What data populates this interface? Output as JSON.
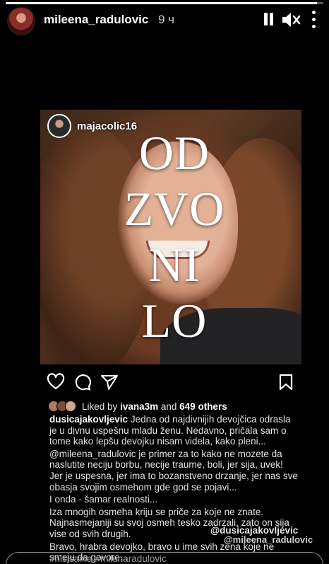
{
  "story": {
    "progress": 0.98,
    "username": "mileena_radulovic",
    "time": "9 ч"
  },
  "post": {
    "username": "majacolic16",
    "big_text_lines": [
      "OD",
      "ZVO",
      "NI",
      "LO"
    ],
    "liked_by_prefix": "Liked by",
    "liked_by_user": "ivana3m",
    "liked_by_and": "and",
    "liked_by_count": "649 others",
    "caption_user": "dusicajakovljevic",
    "caption_lines": [
      "Jedna od najdivnijih devojčica odrasla je u divnu uspešnu mladu ženu. Nedavno, pričala sam o tome kako lepšu devojku nisam videla, kako pleni...",
      "@mileena_radulovic je primer za to kako ne mozete da naslutite neciju borbu, necije traume, boli, jer sija, uvek! Jer je uspesna, jer ima to bozanstveno drzanje, jer nas sve obasja svojim osmehom gde god se pojavi...",
      "I onda - šamar realnosti...",
      "Iza mnogih osmeha kriju se priče za koje ne znate. Najnasmejaniji su svoj osmeh tesko zadrzali, zato on sija vise od svih drugih.",
      "Bravo, hrabra devojko, bravo u ime svih zena koje ne smeju da govore..."
    ],
    "hashtags": "#nisisama #milenaradulovic"
  },
  "sticker": {
    "mention_1": "@dusicajakovljevic",
    "mention_2": "@mileena_radulovic"
  }
}
